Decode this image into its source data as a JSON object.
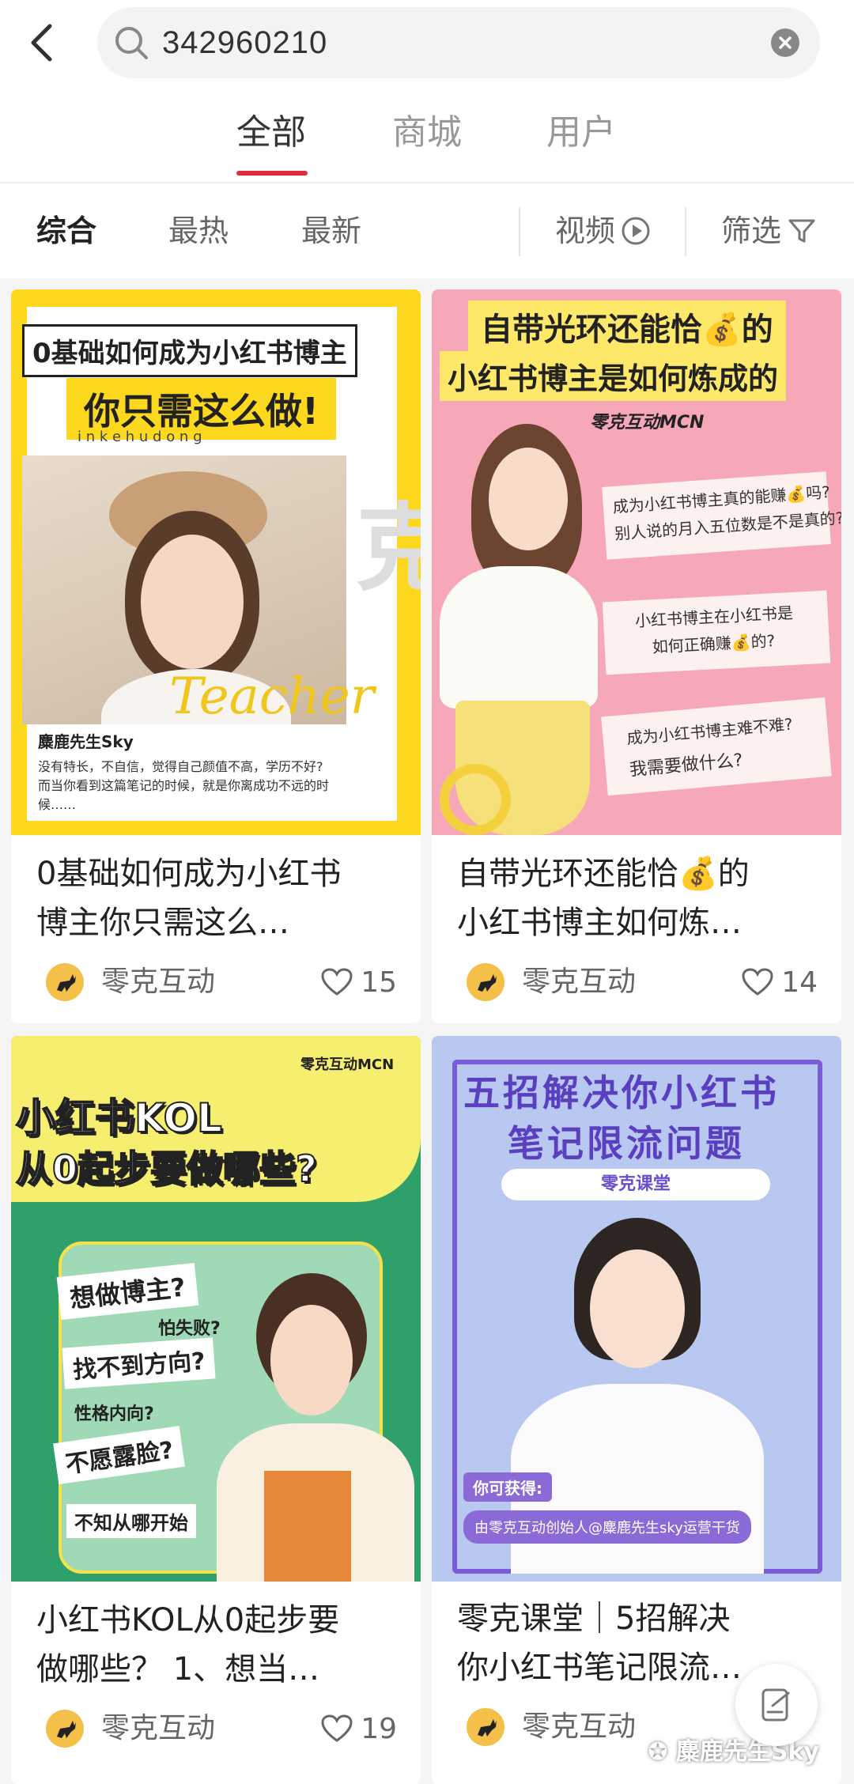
{
  "search": {
    "query": "342960210"
  },
  "tabs": [
    {
      "label": "全部",
      "active": true
    },
    {
      "label": "商城",
      "active": false
    },
    {
      "label": "用户",
      "active": false
    }
  ],
  "filters": {
    "sort": [
      "综合",
      "最热",
      "最新"
    ],
    "video_label": "视频",
    "filter_label": "筛选"
  },
  "colors": {
    "accent": "#e4283d",
    "card1_bg": "#fcd81e",
    "card2_bg": "#f6a8b8",
    "card3_bg": "#2fa06a",
    "card4_bg": "#b9c8f0"
  },
  "cards": [
    {
      "title_line1": "0基础如何成为小红书",
      "title_line2": "博主你只需这么…",
      "author": "零克互动",
      "likes": "15",
      "cover": {
        "headline1": "0基础如何成为小红书博主",
        "headline2": "你只需这么做!",
        "tagline": "i n k e h u d o n g",
        "name": "麋鹿先生Sky",
        "script_word": "Teacher",
        "desc1": "没有特长，不自信，觉得自己颜值不高，学历不好?",
        "desc2": "而当你看到这篇笔记的时候，就是你离成功不远的时",
        "desc3": "候……"
      }
    },
    {
      "title_line1": "自带光环还能恰💰的",
      "title_line2": "小红书博主如何炼…",
      "author": "零克互动",
      "likes": "14",
      "cover": {
        "headline1": "自带光环还能恰💰的",
        "headline2": "小红书博主是如何炼成的",
        "brand": "零克互动MCN",
        "q1a": "成为小红书博主真的能赚💰吗?",
        "q1b": "别人说的月入五位数是不是真的?",
        "q2a": "小红书博主在小红书是",
        "q2b": "如何正确赚💰的?",
        "q3a": "成为小红书博主难不难?",
        "q3b": "我需要做什么?"
      }
    },
    {
      "title_line1": "小红书KOL从0起步要",
      "title_line2": "做哪些？ 1、想当…",
      "author": "零克互动",
      "likes": "19",
      "cover": {
        "brand": "零克互动MCN",
        "headline1": "小红书KOL",
        "headline2": "从0起步要做哪些?",
        "t1": "想做博主?",
        "t2": "怕失败?",
        "t3": "找不到方向?",
        "t4": "性格内向?",
        "t5": "不愿露脸?",
        "t6": "不知从哪开始"
      }
    },
    {
      "title_line1": "零克课堂｜5招解决",
      "title_line2": "你小红书笔记限流…",
      "author": "零克互动",
      "likes": "",
      "cover": {
        "headline1": "五招解决你小红书",
        "headline2": "笔记限流问题",
        "badge": "零克课堂",
        "gain": "你可获得:",
        "footer": "由零克互动创始人@麋鹿先生sky运营干货"
      }
    }
  ],
  "watermark": "麋鹿先生Sky"
}
